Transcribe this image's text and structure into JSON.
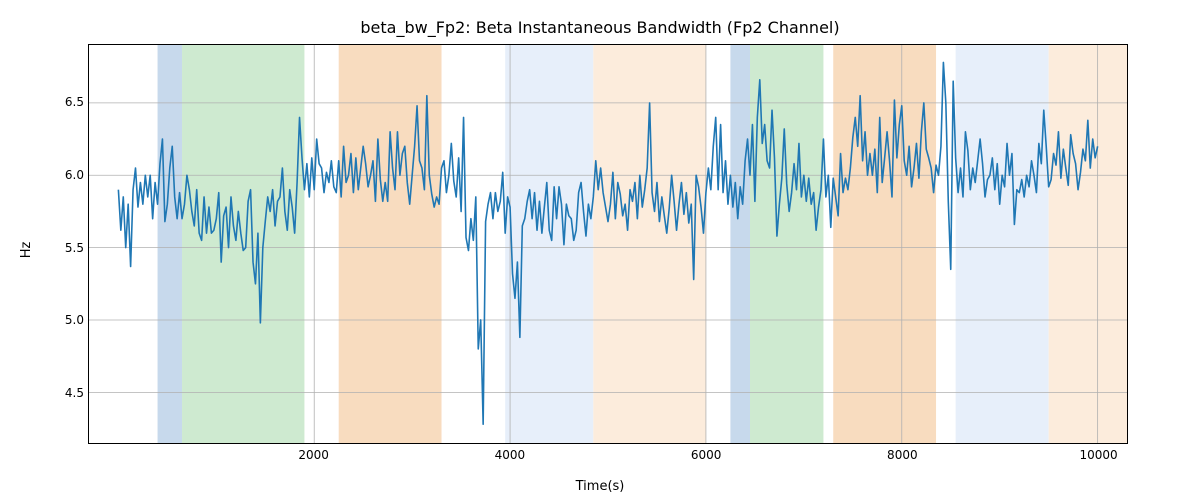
{
  "chart_data": {
    "type": "line",
    "title": "beta_bw_Fp2: Beta Instantaneous Bandwidth (Fp2 Channel)",
    "xlabel": "Time(s)",
    "ylabel": "Hz",
    "xlim": [
      -300,
      10300
    ],
    "ylim": [
      4.15,
      6.9
    ],
    "xticks": [
      2000,
      4000,
      6000,
      8000,
      10000
    ],
    "yticks": [
      4.5,
      5.0,
      5.5,
      6.0,
      6.5
    ],
    "line_color": "#1f77b4",
    "grid": true,
    "grid_color": "#b0b0b0",
    "spans": [
      {
        "from": 400,
        "to": 650,
        "color": "#c7d9ec"
      },
      {
        "from": 650,
        "to": 1900,
        "color": "#ceead0"
      },
      {
        "from": 2250,
        "to": 3300,
        "color": "#f8dcbf"
      },
      {
        "from": 3950,
        "to": 4850,
        "color": "#e7effa"
      },
      {
        "from": 4850,
        "to": 6000,
        "color": "#fcecdc"
      },
      {
        "from": 6250,
        "to": 6450,
        "color": "#c7d9ec"
      },
      {
        "from": 6450,
        "to": 7200,
        "color": "#ceead0"
      },
      {
        "from": 7300,
        "to": 8350,
        "color": "#f8dcbf"
      },
      {
        "from": 8550,
        "to": 9500,
        "color": "#e7effa"
      },
      {
        "from": 9500,
        "to": 10300,
        "color": "#fcecdc"
      }
    ],
    "x": [
      0,
      25,
      50,
      75,
      100,
      125,
      150,
      175,
      200,
      225,
      250,
      275,
      300,
      325,
      350,
      375,
      400,
      425,
      450,
      475,
      500,
      525,
      550,
      575,
      600,
      625,
      650,
      675,
      700,
      725,
      750,
      775,
      800,
      825,
      850,
      875,
      900,
      925,
      950,
      975,
      1000,
      1025,
      1050,
      1075,
      1100,
      1125,
      1150,
      1175,
      1200,
      1225,
      1250,
      1275,
      1300,
      1325,
      1350,
      1375,
      1400,
      1425,
      1450,
      1475,
      1500,
      1525,
      1550,
      1575,
      1600,
      1625,
      1650,
      1675,
      1700,
      1725,
      1750,
      1775,
      1800,
      1825,
      1850,
      1875,
      1900,
      1925,
      1950,
      1975,
      2000,
      2025,
      2050,
      2075,
      2100,
      2125,
      2150,
      2175,
      2200,
      2225,
      2250,
      2275,
      2300,
      2325,
      2350,
      2375,
      2400,
      2425,
      2450,
      2475,
      2500,
      2525,
      2550,
      2575,
      2600,
      2625,
      2650,
      2675,
      2700,
      2725,
      2750,
      2775,
      2800,
      2825,
      2850,
      2875,
      2900,
      2925,
      2950,
      2975,
      3000,
      3025,
      3050,
      3075,
      3100,
      3125,
      3150,
      3175,
      3200,
      3225,
      3250,
      3275,
      3300,
      3325,
      3350,
      3375,
      3400,
      3425,
      3450,
      3475,
      3500,
      3525,
      3550,
      3575,
      3600,
      3625,
      3650,
      3675,
      3700,
      3725,
      3750,
      3775,
      3800,
      3825,
      3850,
      3875,
      3900,
      3925,
      3950,
      3975,
      4000,
      4025,
      4050,
      4075,
      4100,
      4125,
      4150,
      4175,
      4200,
      4225,
      4250,
      4275,
      4300,
      4325,
      4350,
      4375,
      4400,
      4425,
      4450,
      4475,
      4500,
      4525,
      4550,
      4575,
      4600,
      4625,
      4650,
      4675,
      4700,
      4725,
      4750,
      4775,
      4800,
      4825,
      4850,
      4875,
      4900,
      4925,
      4950,
      4975,
      5000,
      5025,
      5050,
      5075,
      5100,
      5125,
      5150,
      5175,
      5200,
      5225,
      5250,
      5275,
      5300,
      5325,
      5350,
      5375,
      5400,
      5425,
      5450,
      5475,
      5500,
      5525,
      5550,
      5575,
      5600,
      5625,
      5650,
      5675,
      5700,
      5725,
      5750,
      5775,
      5800,
      5825,
      5850,
      5875,
      5900,
      5925,
      5950,
      5975,
      6000,
      6025,
      6050,
      6075,
      6100,
      6125,
      6150,
      6175,
      6200,
      6225,
      6250,
      6275,
      6300,
      6325,
      6350,
      6375,
      6400,
      6425,
      6450,
      6475,
      6500,
      6525,
      6550,
      6575,
      6600,
      6625,
      6650,
      6675,
      6700,
      6725,
      6750,
      6775,
      6800,
      6825,
      6850,
      6875,
      6900,
      6925,
      6950,
      6975,
      7000,
      7025,
      7050,
      7075,
      7100,
      7125,
      7150,
      7175,
      7200,
      7225,
      7250,
      7275,
      7300,
      7325,
      7350,
      7375,
      7400,
      7425,
      7450,
      7475,
      7500,
      7525,
      7550,
      7575,
      7600,
      7625,
      7650,
      7675,
      7700,
      7725,
      7750,
      7775,
      7800,
      7825,
      7850,
      7875,
      7900,
      7925,
      7950,
      7975,
      8000,
      8025,
      8050,
      8075,
      8100,
      8125,
      8150,
      8175,
      8200,
      8225,
      8250,
      8275,
      8300,
      8325,
      8350,
      8375,
      8400,
      8425,
      8450,
      8475,
      8500,
      8525,
      8550,
      8575,
      8600,
      8625,
      8650,
      8675,
      8700,
      8725,
      8750,
      8775,
      8800,
      8825,
      8850,
      8875,
      8900,
      8925,
      8950,
      8975,
      9000,
      9025,
      9050,
      9075,
      9100,
      9125,
      9150,
      9175,
      9200,
      9225,
      9250,
      9275,
      9300,
      9325,
      9350,
      9375,
      9400,
      9425,
      9450,
      9475,
      9500,
      9525,
      9550,
      9575,
      9600,
      9625,
      9650,
      9675,
      9700,
      9725,
      9750,
      9775,
      9800,
      9825,
      9850,
      9875,
      9900,
      9925,
      9950,
      9975,
      10000
    ],
    "values": [
      5.9,
      5.62,
      5.85,
      5.5,
      5.8,
      5.37,
      5.9,
      6.05,
      5.78,
      5.95,
      5.8,
      6.0,
      5.85,
      6.0,
      5.7,
      5.95,
      5.8,
      6.08,
      6.25,
      5.68,
      5.8,
      6.05,
      6.2,
      5.85,
      5.7,
      5.88,
      5.7,
      5.8,
      6.0,
      5.9,
      5.75,
      5.65,
      5.9,
      5.6,
      5.55,
      5.85,
      5.6,
      5.78,
      5.6,
      5.62,
      5.7,
      5.88,
      5.4,
      5.72,
      5.78,
      5.5,
      5.85,
      5.65,
      5.55,
      5.75,
      5.6,
      5.48,
      5.5,
      5.82,
      5.9,
      5.4,
      5.25,
      5.6,
      4.98,
      5.5,
      5.68,
      5.85,
      5.75,
      5.9,
      5.65,
      5.82,
      5.85,
      6.05,
      5.75,
      5.62,
      5.9,
      5.78,
      5.6,
      5.95,
      6.4,
      6.12,
      5.9,
      6.08,
      5.85,
      6.12,
      5.9,
      6.25,
      6.08,
      6.05,
      5.88,
      6.02,
      5.95,
      6.1,
      5.92,
      5.88,
      6.1,
      5.85,
      6.2,
      5.95,
      6.0,
      6.15,
      5.88,
      6.12,
      5.9,
      6.05,
      6.2,
      6.08,
      5.92,
      6.0,
      6.1,
      5.82,
      6.25,
      5.97,
      5.82,
      5.95,
      5.82,
      6.3,
      6.05,
      5.9,
      6.3,
      6.0,
      6.15,
      6.2,
      5.95,
      5.8,
      6.0,
      6.2,
      6.48,
      6.1,
      6.05,
      5.9,
      6.55,
      6.0,
      5.87,
      5.78,
      5.85,
      5.8,
      6.05,
      6.1,
      5.88,
      6.0,
      6.22,
      5.96,
      5.85,
      6.12,
      5.75,
      6.4,
      5.57,
      5.48,
      5.7,
      5.55,
      5.85,
      4.8,
      5.0,
      4.28,
      5.68,
      5.8,
      5.88,
      5.7,
      5.88,
      5.75,
      5.82,
      6.02,
      5.6,
      5.85,
      5.78,
      5.32,
      5.15,
      5.4,
      4.88,
      5.65,
      5.7,
      5.82,
      5.9,
      5.7,
      5.88,
      5.62,
      5.82,
      5.6,
      5.78,
      5.95,
      5.62,
      5.55,
      5.92,
      5.7,
      5.92,
      5.8,
      5.52,
      5.8,
      5.72,
      5.7,
      5.55,
      5.62,
      5.88,
      5.95,
      5.75,
      5.58,
      5.8,
      5.7,
      5.85,
      6.1,
      5.9,
      6.05,
      5.88,
      5.78,
      5.68,
      5.8,
      6.02,
      5.7,
      5.95,
      5.87,
      5.72,
      5.8,
      5.62,
      5.9,
      5.82,
      5.95,
      5.7,
      6.0,
      5.78,
      5.9,
      6.05,
      6.5,
      5.88,
      5.75,
      5.95,
      5.68,
      5.85,
      5.72,
      5.6,
      5.77,
      6.0,
      5.82,
      5.62,
      5.8,
      5.95,
      5.73,
      5.88,
      5.67,
      5.8,
      5.28,
      6.0,
      5.92,
      5.78,
      5.6,
      5.88,
      6.05,
      5.9,
      6.2,
      6.4,
      5.9,
      6.35,
      5.88,
      6.1,
      5.8,
      6.0,
      5.78,
      5.95,
      5.7,
      5.92,
      5.8,
      6.1,
      6.25,
      6.0,
      6.35,
      5.82,
      6.4,
      6.66,
      6.22,
      6.35,
      6.1,
      6.05,
      6.45,
      6.12,
      5.58,
      5.8,
      5.98,
      6.32,
      5.94,
      5.75,
      5.88,
      6.08,
      5.9,
      6.22,
      5.85,
      6.0,
      5.82,
      5.98,
      5.8,
      5.88,
      5.62,
      5.78,
      5.9,
      6.25,
      5.85,
      6.0,
      5.64,
      5.98,
      5.85,
      5.72,
      6.15,
      5.88,
      5.98,
      5.9,
      6.05,
      6.26,
      6.4,
      6.2,
      6.55,
      6.1,
      6.3,
      6.0,
      6.15,
      6.0,
      6.18,
      5.88,
      6.4,
      5.95,
      6.12,
      6.3,
      6.1,
      5.85,
      6.52,
      6.12,
      6.35,
      6.48,
      6.1,
      6.0,
      6.2,
      5.92,
      6.05,
      6.22,
      5.98,
      6.3,
      6.5,
      6.18,
      6.12,
      6.05,
      5.88,
      6.07,
      6.0,
      6.2,
      6.78,
      6.5,
      5.82,
      5.35,
      6.65,
      6.12,
      5.88,
      6.05,
      5.85,
      6.3,
      6.17,
      5.9,
      6.05,
      5.95,
      6.1,
      6.25,
      6.08,
      5.85,
      5.97,
      6.0,
      6.12,
      5.9,
      6.08,
      5.8,
      6.0,
      5.92,
      6.22,
      6.0,
      6.15,
      5.66,
      5.9,
      5.88,
      5.97,
      5.85,
      6.0,
      5.92,
      6.1,
      6.0,
      5.88,
      6.22,
      6.08,
      6.45,
      6.2,
      5.92,
      5.97,
      6.15,
      6.07,
      6.3,
      5.98,
      6.18,
      6.05,
      5.93,
      6.28,
      6.15,
      6.08,
      5.9,
      6.02,
      6.18,
      6.1,
      6.38,
      6.05,
      6.25,
      6.12,
      6.2
    ]
  }
}
